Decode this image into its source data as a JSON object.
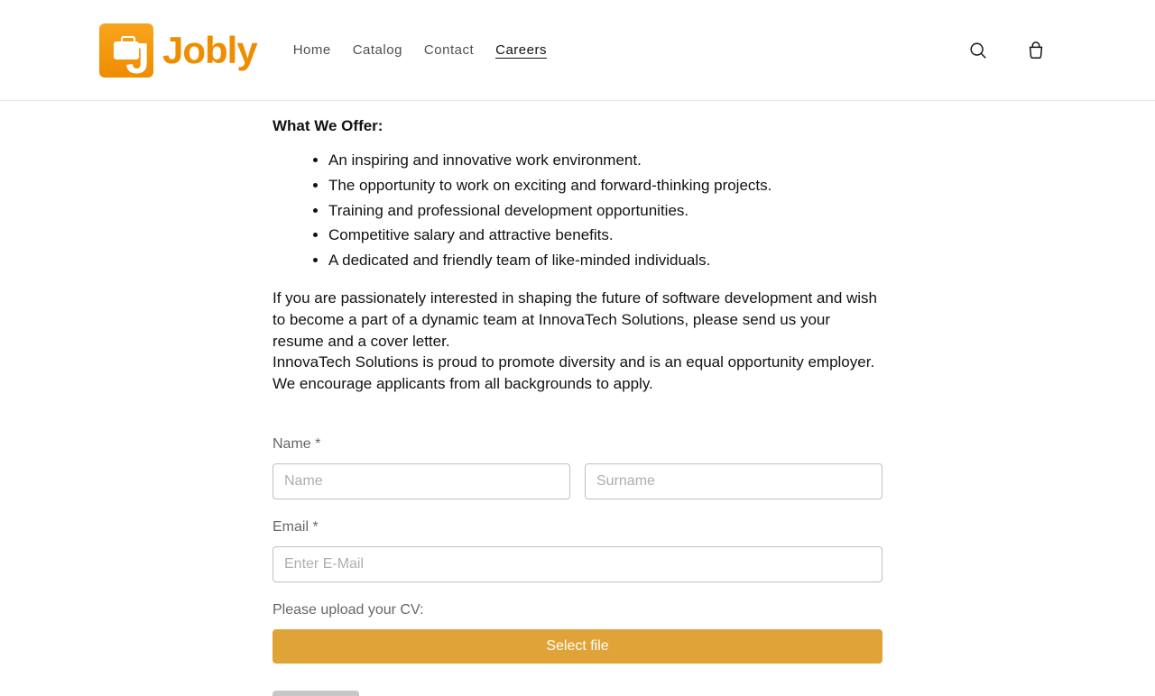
{
  "brand": {
    "name": "Jobly"
  },
  "nav": {
    "home": "Home",
    "catalog": "Catalog",
    "contact": "Contact",
    "careers": "Careers"
  },
  "offer": {
    "heading": "What We Offer:",
    "items": [
      "An inspiring and innovative work environment.",
      "The opportunity to work on exciting and forward-thinking projects.",
      "Training and professional development opportunities.",
      "Competitive salary and attractive benefits.",
      "A dedicated and friendly team of like-minded individuals."
    ]
  },
  "paragraphs": {
    "p1": "If you are passionately interested in shaping the future of software development and wish to become a part of a dynamic team at InnovaTech Solutions, please send us your resume and a cover letter.",
    "p2": "InnovaTech Solutions is proud to promote diversity and is an equal opportunity employer. We encourage applicants from all backgrounds to apply."
  },
  "form": {
    "name_label": "Name *",
    "name_ph": "Name",
    "surname_ph": "Surname",
    "email_label": "Email *",
    "email_ph": "Enter E-Mail",
    "cv_label": "Please upload your CV:",
    "file_btn": "Select file"
  }
}
